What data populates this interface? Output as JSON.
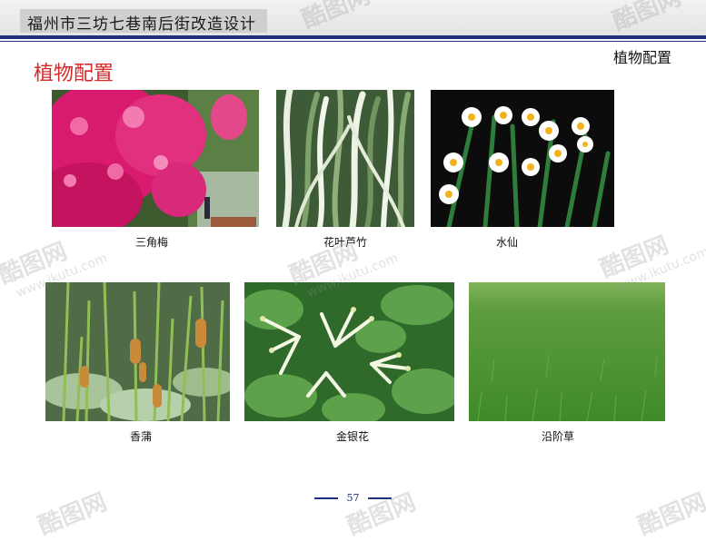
{
  "header": {
    "title": "福州市三坊七巷南后街改造设计"
  },
  "section_tag": "植物配置",
  "page_heading": "植物配置",
  "plants": [
    {
      "caption": "三角梅"
    },
    {
      "caption": "花叶芦竹"
    },
    {
      "caption": "水仙"
    },
    {
      "caption": "香蒲"
    },
    {
      "caption": "金银花"
    },
    {
      "caption": "沿阶草"
    }
  ],
  "footer": {
    "page_number": "57"
  },
  "watermark": {
    "brand": "酷图网",
    "url": "www.ikutu.com"
  }
}
